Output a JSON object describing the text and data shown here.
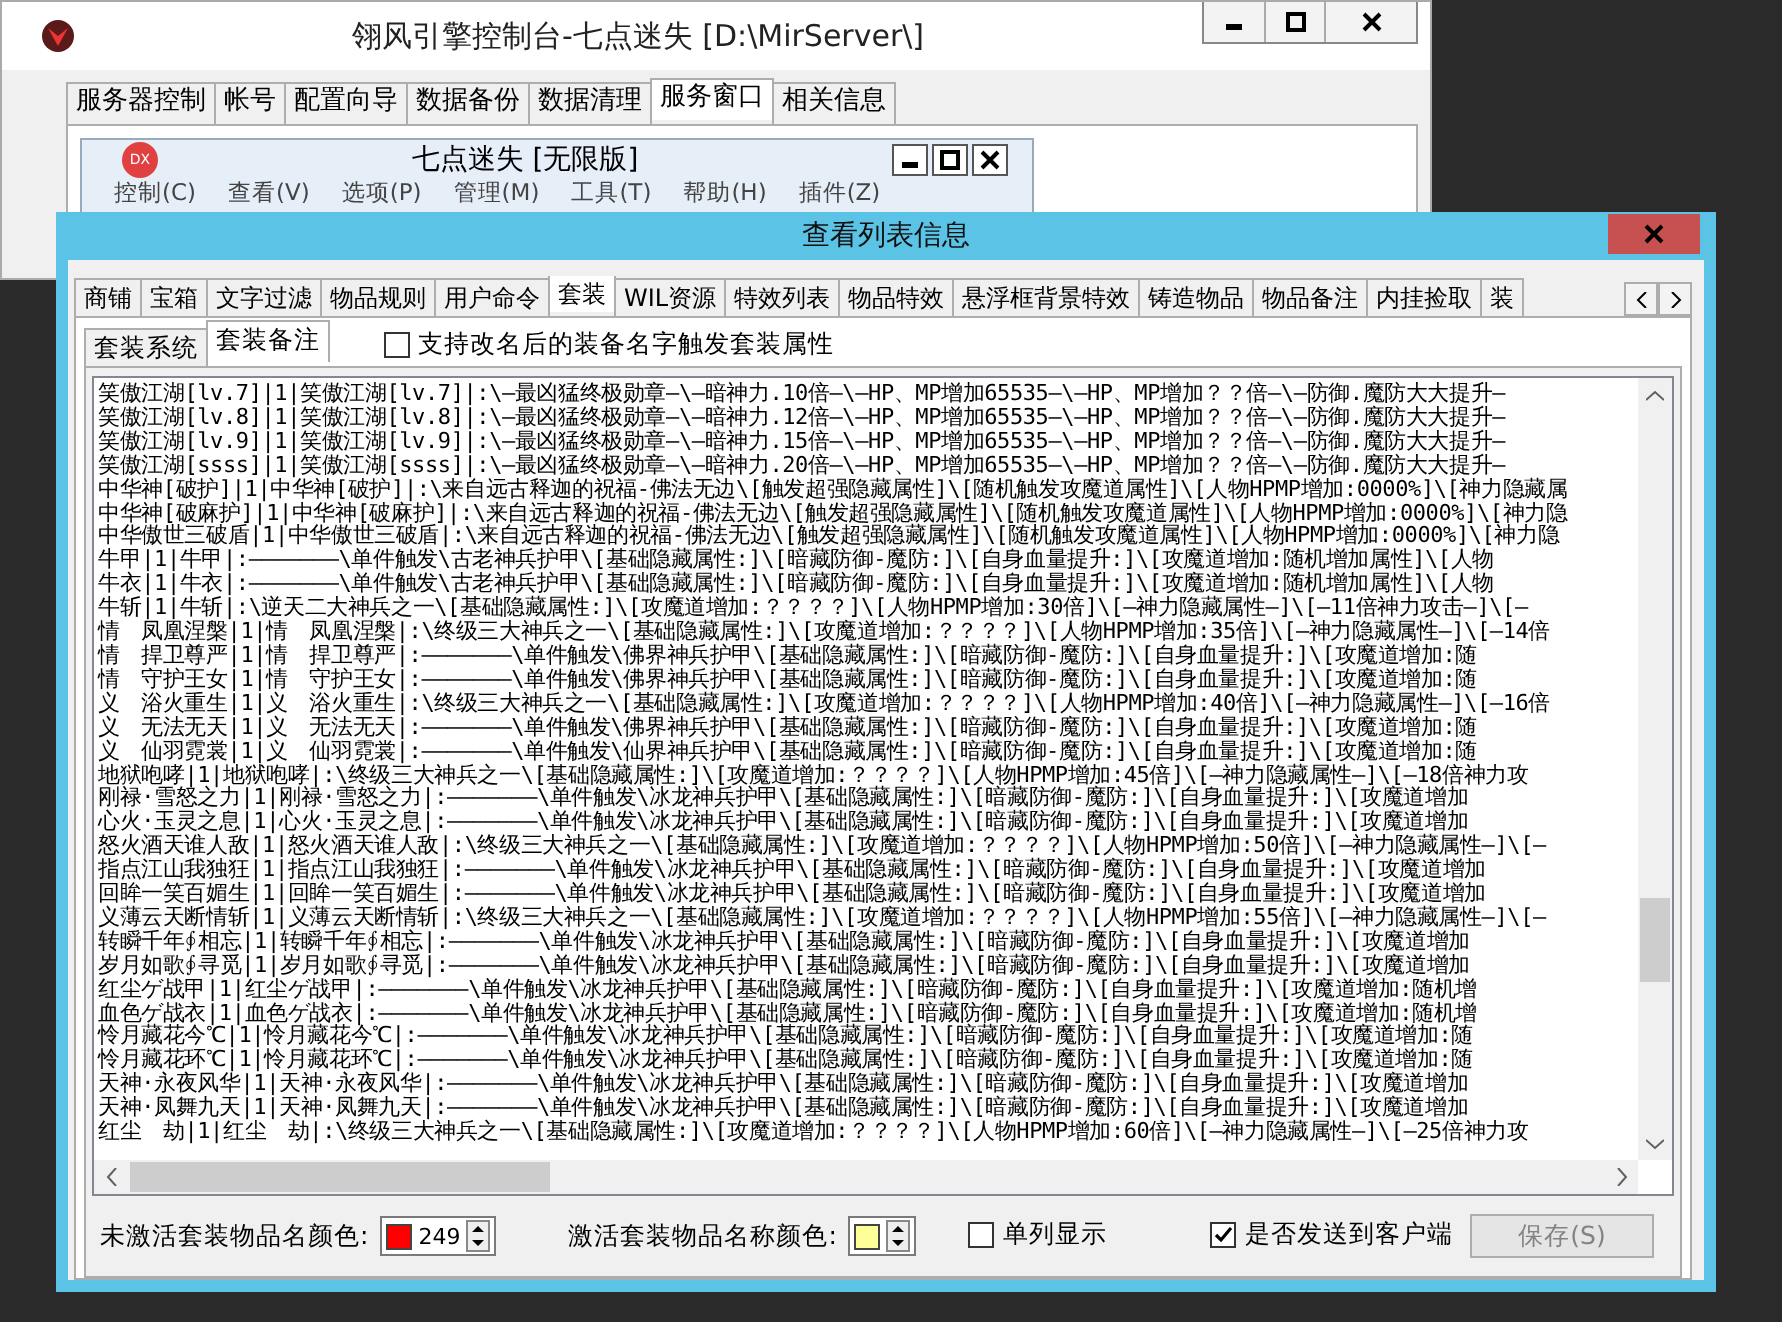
{
  "back_window": {
    "title": "翎风引擎控制台-七点迷失 [D:\\MirServer\\]",
    "tabs": [
      {
        "label": "服务器控制",
        "selected": false
      },
      {
        "label": "帐号",
        "selected": false
      },
      {
        "label": "配置向导",
        "selected": false
      },
      {
        "label": "数据备份",
        "selected": false
      },
      {
        "label": "数据清理",
        "selected": false
      },
      {
        "label": "服务窗口",
        "selected": true
      },
      {
        "label": "相关信息",
        "selected": false
      }
    ],
    "child_window": {
      "title": "七点迷失 [无限版]",
      "logo": "DX",
      "menu": [
        "控制(C)",
        "查看(V)",
        "选项(P)",
        "管理(M)",
        "工具(T)",
        "帮助(H)",
        "插件(Z)"
      ]
    }
  },
  "dialog": {
    "title": "查看列表信息",
    "tabs": [
      {
        "label": "商铺",
        "selected": false
      },
      {
        "label": "宝箱",
        "selected": false
      },
      {
        "label": "文字过滤",
        "selected": false
      },
      {
        "label": "物品规则",
        "selected": false
      },
      {
        "label": "用户命令",
        "selected": false
      },
      {
        "label": "套装",
        "selected": true
      },
      {
        "label": "WIL资源",
        "selected": false
      },
      {
        "label": "特效列表",
        "selected": false
      },
      {
        "label": "物品特效",
        "selected": false
      },
      {
        "label": "悬浮框背景特效",
        "selected": false
      },
      {
        "label": "铸造物品",
        "selected": false
      },
      {
        "label": "物品备注",
        "selected": false
      },
      {
        "label": "内挂捡取",
        "selected": false
      },
      {
        "label": "装",
        "selected": false
      }
    ],
    "subtabs": [
      {
        "label": "套装系统",
        "selected": false
      },
      {
        "label": "套装备注",
        "selected": true
      }
    ],
    "rename_option": {
      "label": "支持改名后的装备名字触发套装属性",
      "checked": false
    },
    "list_rows": [
      "笑傲江湖[lv.7]|1|笑傲江湖[lv.7]|:\\—最凶猛终极勋章—\\—暗神力.10倍—\\—HP、MP增加65535—\\—HP、MP增加？？倍—\\—防御.魔防大大提升—",
      "笑傲江湖[lv.8]|1|笑傲江湖[lv.8]|:\\—最凶猛终极勋章—\\—暗神力.12倍—\\—HP、MP增加65535—\\—HP、MP增加？？倍—\\—防御.魔防大大提升—",
      "笑傲江湖[lv.9]|1|笑傲江湖[lv.9]|:\\—最凶猛终极勋章—\\—暗神力.15倍—\\—HP、MP增加65535—\\—HP、MP增加？？倍—\\—防御.魔防大大提升—",
      "笑傲江湖[ssss]|1|笑傲江湖[ssss]|:\\—最凶猛终极勋章—\\—暗神力.20倍—\\—HP、MP增加65535—\\—HP、MP增加？？倍—\\—防御.魔防大大提升—",
      "中华神[破护]|1|中华神[破护]|:\\来自远古释迦的祝福-佛法无边\\[触发超强隐藏属性]\\[随机触发攻魔道属性]\\[人物HPMP增加:0000%]\\[神力隐藏属",
      "中华神[破麻护]|1|中华神[破麻护]|:\\来自远古释迦的祝福-佛法无边\\[触发超强隐藏属性]\\[随机触发攻魔道属性]\\[人物HPMP增加:0000%]\\[神力隐",
      "中华傲世三破盾|1|中华傲世三破盾|:\\来自远古释迦的祝福-佛法无边\\[触发超强隐藏属性]\\[随机触发攻魔道属性]\\[人物HPMP增加:0000%]\\[神力隐",
      "牛甲|1|牛甲|:———————\\单件触发\\古老神兵护甲\\[基础隐藏属性:]\\[暗藏防御-魔防:]\\[自身血量提升:]\\[攻魔道增加:随机增加属性]\\[人物",
      "牛衣|1|牛衣|:———————\\单件触发\\古老神兵护甲\\[基础隐藏属性:]\\[暗藏防御-魔防:]\\[自身血量提升:]\\[攻魔道增加:随机增加属性]\\[人物",
      "牛斩|1|牛斩|:\\逆天二大神兵之一\\[基础隐藏属性:]\\[攻魔道增加:？？？？]\\[人物HPMP增加:30倍]\\[—神力隐藏属性—]\\[—11倍神力攻击—]\\[—",
      "情　凤凰涅槃|1|情　凤凰涅槃|:\\终级三大神兵之一\\[基础隐藏属性:]\\[攻魔道增加:？？？？]\\[人物HPMP增加:35倍]\\[—神力隐藏属性—]\\[—14倍",
      "情　捍卫尊严|1|情　捍卫尊严|:———————\\单件触发\\佛界神兵护甲\\[基础隐藏属性:]\\[暗藏防御-魔防:]\\[自身血量提升:]\\[攻魔道增加:随",
      "情　守护王女|1|情　守护王女|:———————\\单件触发\\佛界神兵护甲\\[基础隐藏属性:]\\[暗藏防御-魔防:]\\[自身血量提升:]\\[攻魔道增加:随",
      "义　浴火重生|1|义　浴火重生|:\\终级三大神兵之一\\[基础隐藏属性:]\\[攻魔道增加:？？？？]\\[人物HPMP增加:40倍]\\[—神力隐藏属性—]\\[—16倍",
      "义　无法无天|1|义　无法无天|:———————\\单件触发\\佛界神兵护甲\\[基础隐藏属性:]\\[暗藏防御-魔防:]\\[自身血量提升:]\\[攻魔道增加:随",
      "义　仙羽霓裳|1|义　仙羽霓裳|:———————\\单件触发\\仙界神兵护甲\\[基础隐藏属性:]\\[暗藏防御-魔防:]\\[自身血量提升:]\\[攻魔道增加:随",
      "地狱咆哮|1|地狱咆哮|:\\终级三大神兵之一\\[基础隐藏属性:]\\[攻魔道增加:？？？？]\\[人物HPMP增加:45倍]\\[—神力隐藏属性—]\\[—18倍神力攻",
      "刚禄·雪怒之力|1|刚禄·雪怒之力|:———————\\单件触发\\冰龙神兵护甲\\[基础隐藏属性:]\\[暗藏防御-魔防:]\\[自身血量提升:]\\[攻魔道增加",
      "心火·玉灵之息|1|心火·玉灵之息|:———————\\单件触发\\冰龙神兵护甲\\[基础隐藏属性:]\\[暗藏防御-魔防:]\\[自身血量提升:]\\[攻魔道增加",
      "怒火酒天谁人敌|1|怒火酒天谁人敌|:\\终级三大神兵之一\\[基础隐藏属性:]\\[攻魔道增加:？？？？]\\[人物HPMP增加:50倍]\\[—神力隐藏属性—]\\[—",
      "指点江山我独狂|1|指点江山我独狂|:———————\\单件触发\\冰龙神兵护甲\\[基础隐藏属性:]\\[暗藏防御-魔防:]\\[自身血量提升:]\\[攻魔道增加",
      "回眸一笑百媚生|1|回眸一笑百媚生|:———————\\单件触发\\冰龙神兵护甲\\[基础隐藏属性:]\\[暗藏防御-魔防:]\\[自身血量提升:]\\[攻魔道增加",
      "义薄云天断情斩|1|义薄云天断情斩|:\\终级三大神兵之一\\[基础隐藏属性:]\\[攻魔道增加:？？？？]\\[人物HPMP增加:55倍]\\[—神力隐藏属性—]\\[—",
      "转瞬千年∮相忘|1|转瞬千年∮相忘|:———————\\单件触发\\冰龙神兵护甲\\[基础隐藏属性:]\\[暗藏防御-魔防:]\\[自身血量提升:]\\[攻魔道增加",
      "岁月如歌∮寻觅|1|岁月如歌∮寻觅|:———————\\单件触发\\冰龙神兵护甲\\[基础隐藏属性:]\\[暗藏防御-魔防:]\\[自身血量提升:]\\[攻魔道增加",
      "红尘ゲ战甲|1|红尘ゲ战甲|:———————\\单件触发\\冰龙神兵护甲\\[基础隐藏属性:]\\[暗藏防御-魔防:]\\[自身血量提升:]\\[攻魔道增加:随机增",
      "血色ゲ战衣|1|血色ゲ战衣|:———————\\单件触发\\冰龙神兵护甲\\[基础隐藏属性:]\\[暗藏防御-魔防:]\\[自身血量提升:]\\[攻魔道增加:随机增",
      "怜月藏花今℃|1|怜月藏花今℃|:———————\\单件触发\\冰龙神兵护甲\\[基础隐藏属性:]\\[暗藏防御-魔防:]\\[自身血量提升:]\\[攻魔道增加:随",
      "怜月藏花环℃|1|怜月藏花环℃|:———————\\单件触发\\冰龙神兵护甲\\[基础隐藏属性:]\\[暗藏防御-魔防:]\\[自身血量提升:]\\[攻魔道增加:随",
      "天神·永夜风华|1|天神·永夜风华|:———————\\单件触发\\冰龙神兵护甲\\[基础隐藏属性:]\\[暗藏防御-魔防:]\\[自身血量提升:]\\[攻魔道增加",
      "天神·凤舞九天|1|天神·凤舞九天|:———————\\单件触发\\冰龙神兵护甲\\[基础隐藏属性:]\\[暗藏防御-魔防:]\\[自身血量提升:]\\[攻魔道增加",
      "红尘　劫|1|红尘　劫|:\\终级三大神兵之一\\[基础隐藏属性:]\\[攻魔道增加:？？？？]\\[人物HPMP增加:60倍]\\[—神力隐藏属性—]\\[—25倍神力攻"
    ],
    "footer": {
      "inactive_color": {
        "label": "未激活套装物品名颜色:",
        "color": "#ff0000",
        "value": "249"
      },
      "active_color": {
        "label": "激活套装物品名称颜色:",
        "color": "#ffff99"
      },
      "single_column": {
        "label": "单列显示",
        "checked": false
      },
      "send_to_client": {
        "label": "是否发送到客户端",
        "checked": true
      },
      "save_button": {
        "label": "保存(S)",
        "disabled": true
      }
    }
  }
}
